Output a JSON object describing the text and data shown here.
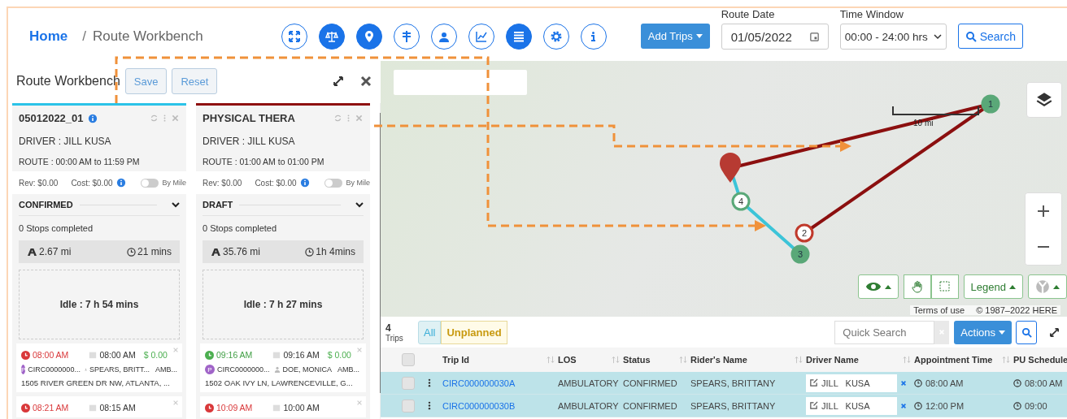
{
  "header": {
    "home": "Home",
    "separator": "/",
    "current": "Route Workbench",
    "toolbar": [
      {
        "kind": "expand",
        "selected": false
      },
      {
        "kind": "scale",
        "selected": true
      },
      {
        "kind": "pin",
        "selected": true
      },
      {
        "kind": "signpost",
        "selected": false
      },
      {
        "kind": "person",
        "selected": false
      },
      {
        "kind": "chart",
        "selected": false
      },
      {
        "kind": "list",
        "selected": true
      },
      {
        "kind": "gear",
        "selected": false
      },
      {
        "kind": "info",
        "selected": false
      }
    ],
    "add_trips": "Add Trips",
    "route_date": {
      "label": "Route Date",
      "value": "01/05/2022"
    },
    "time_window": {
      "label": "Time Window",
      "value": "00:00 - 24:00 hrs"
    },
    "search": "Search"
  },
  "workbench": {
    "title": "Route Workbench",
    "buttons": [
      "Save",
      "Reset"
    ],
    "routes": [
      {
        "title": "05012022_01",
        "info": true,
        "color": "#2bc3e8",
        "driver": "DRIVER : JILL KUSA",
        "route": "ROUTE : 00:00 AM to 11:59 PM",
        "rev": "Rev: $0.00",
        "cost": "Cost: $0.00",
        "by_mile": {
          "label": "By Mile",
          "on": false
        },
        "status": "CONFIRMED",
        "stops": "0 Stops completed",
        "distance": "2.67 mi",
        "duration": "21 mins",
        "idle": "Idle : 7 h 54 mins",
        "trips": [
          {
            "eta": "08:00 AM",
            "late": true,
            "appt": "08:00 AM",
            "price": "$ 0.00",
            "badge": "P",
            "id": "CIRC0000000...",
            "rider": "SPEARS, BRITT...",
            "los": "AMB...",
            "address": "1505 RIVER GREEN DR NW, ATLANTA, ..."
          },
          {
            "eta": "08:21 AM",
            "late": true,
            "appt": "08:15 AM"
          }
        ]
      },
      {
        "title": "PHYSICAL THERA",
        "info": false,
        "color": "#8e1010",
        "driver": "DRIVER : JILL KUSA",
        "route": "ROUTE : 01:00 AM to 01:00 PM",
        "rev": "Rev: $0.00",
        "cost": "Cost: $0.00",
        "by_mile": {
          "label": "By Mile",
          "on": false
        },
        "status": "DRAFT",
        "stops": "0 Stops completed",
        "distance": "35.76 mi",
        "duration": "1h 4mins",
        "idle": "Idle : 7 h 27 mins",
        "trips": [
          {
            "eta": "09:16 AM",
            "late": false,
            "appt": "09:16 AM",
            "price": "$ 0.00",
            "badge": "P",
            "id": "CIRC0000000...",
            "rider": "DOE, MONICA",
            "los": "AMB...",
            "address": "1502 OAK IVY LN, LAWRENCEVILLE, G..."
          },
          {
            "eta": "10:09 AM",
            "late": true,
            "appt": "10:00 AM"
          }
        ]
      }
    ]
  },
  "map": {
    "scale": "10 mi",
    "stops": [
      {
        "label": "1",
        "color": "#5aa878",
        "filled": true
      },
      {
        "label": "2",
        "color": "#c0392b",
        "filled": false
      },
      {
        "label": "3",
        "color": "#5aa878",
        "filled": true
      },
      {
        "label": "4",
        "color": "#5aa878",
        "filled": false
      }
    ],
    "legend": "Legend",
    "terms": "Terms of use",
    "copyright": "© 1987–2022 HERE"
  },
  "trips": {
    "count": "4",
    "count_label": "Trips",
    "filters": [
      {
        "label": "All",
        "selected": true
      },
      {
        "label": "Unplanned",
        "selected": false
      }
    ],
    "quick_search": {
      "placeholder": "Quick Search"
    },
    "actions": "Actions",
    "select_all": {
      "checked": false
    },
    "columns": [
      "Trip Id",
      "LOS",
      "Status",
      "Rider's Name",
      "Driver Name",
      "Appointment Time",
      "PU Schedule"
    ],
    "rows": [
      {
        "selected": true,
        "checked": false,
        "trip_id": "CIRC000000030A",
        "los": "AMBULATORY",
        "status": "CONFIRMED",
        "rider": "SPEARS, BRITTANY",
        "driver": "JILL   KUSA",
        "appointment": "08:00 AM",
        "pu_schedule": "08:00 AM"
      },
      {
        "selected": true,
        "checked": false,
        "trip_id": "CIRC000000030B",
        "los": "AMBULATORY",
        "status": "CONFIRMED",
        "rider": "SPEARS, BRITTANY",
        "driver": "JILL   KUSA",
        "appointment": "12:00 PM",
        "pu_schedule": "09:00"
      }
    ]
  }
}
